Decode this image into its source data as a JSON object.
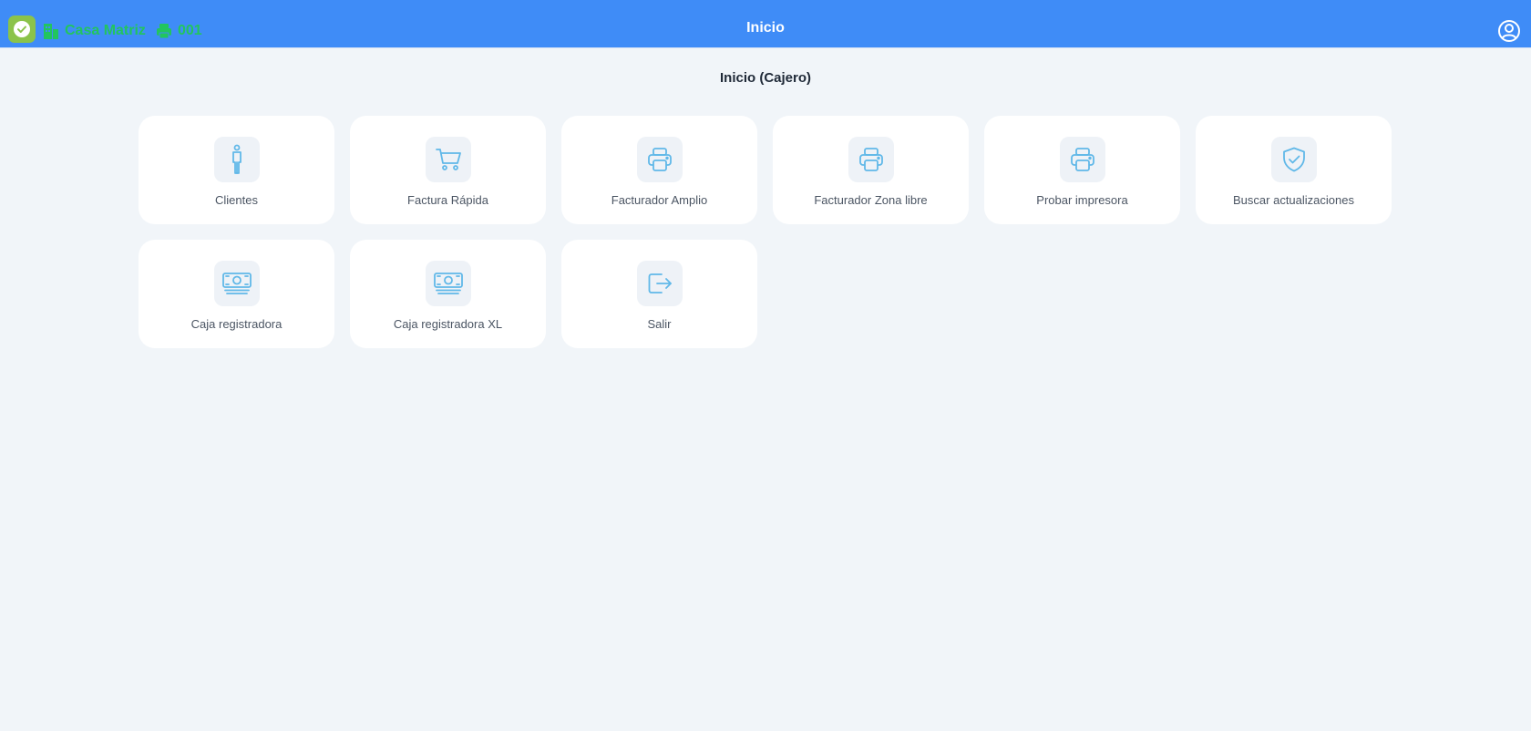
{
  "topbar": {
    "branch": "Casa Matriz",
    "printer": "001",
    "title": "Inicio",
    "color": "#3f8cf7",
    "accent": "#22c55e"
  },
  "page": {
    "title": "Inicio (Cajero)"
  },
  "tiles": [
    {
      "label": "Clientes",
      "icon": "person-icon"
    },
    {
      "label": "Factura Rápida",
      "icon": "cart-icon"
    },
    {
      "label": "Facturador Amplio",
      "icon": "printer-icon"
    },
    {
      "label": "Facturador Zona libre",
      "icon": "printer-icon"
    },
    {
      "label": "Probar impresora",
      "icon": "printer-icon"
    },
    {
      "label": "Buscar actualizaciones",
      "icon": "shield-check-icon"
    },
    {
      "label": "Caja registradora",
      "icon": "cash-icon"
    },
    {
      "label": "Caja registradora XL",
      "icon": "cash-icon"
    },
    {
      "label": "Salir",
      "icon": "logout-icon"
    }
  ]
}
